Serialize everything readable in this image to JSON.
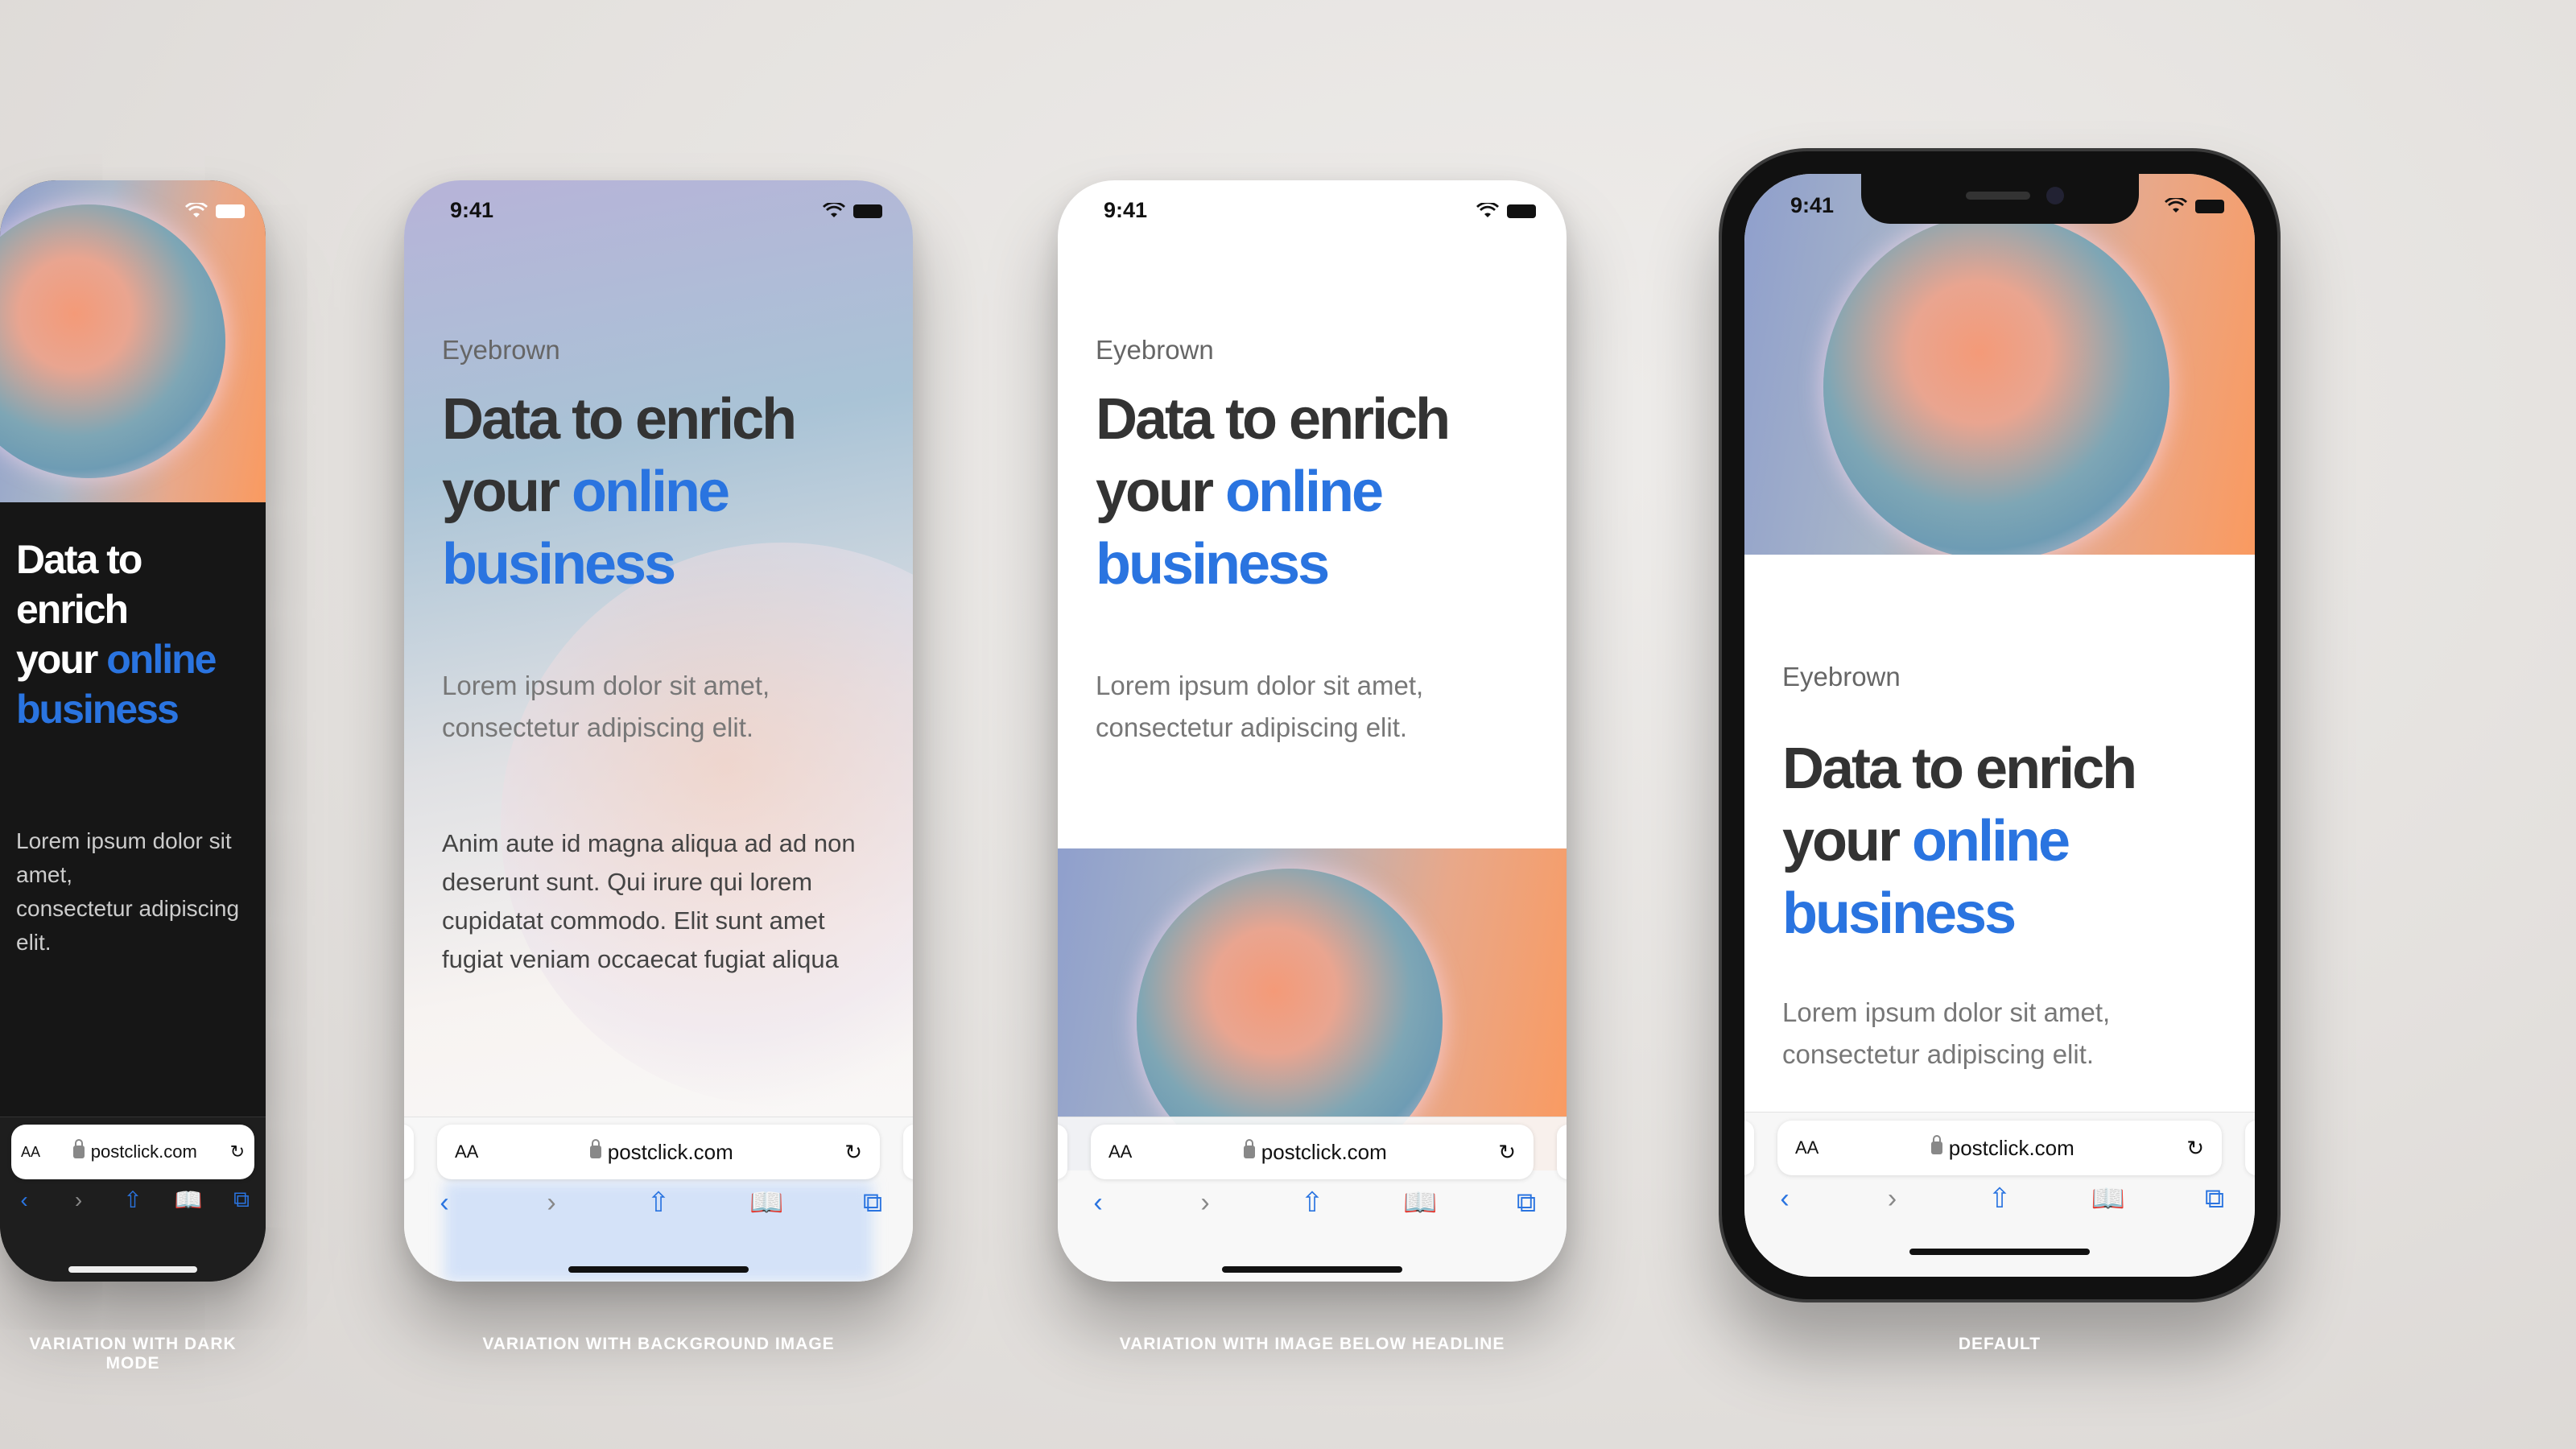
{
  "status": {
    "time": "9:41"
  },
  "content": {
    "eyebrow": "Eyebrown",
    "headline_line1": "Data to enrich",
    "headline_your": "your ",
    "headline_online": "online",
    "headline_business": "business",
    "body_line1": "Lorem ipsum dolor sit amet,",
    "body_line2": "consectetur adipiscing elit.",
    "extra_paragraph": "Anim aute id magna aliqua ad ad non deserunt sunt. Qui irure qui lorem cupidatat commodo. Elit sunt amet fugiat veniam occaecat fugiat aliqua"
  },
  "browser": {
    "text_size": "AA",
    "url": "postclick.com",
    "reload": "↻",
    "back": "‹",
    "forward": "›",
    "share": "⇧",
    "bookmarks": "📖",
    "tabs": "⧉"
  },
  "labels": {
    "dark": "VARIATION WITH DARK MODE",
    "background": "VARIATION WITH BACKGROUND IMAGE",
    "below": "VARIATION WITH IMAGE BELOW HEADLINE",
    "default": "DEFAULT"
  },
  "colors": {
    "accent": "#2a74e0",
    "headline": "#333333"
  }
}
